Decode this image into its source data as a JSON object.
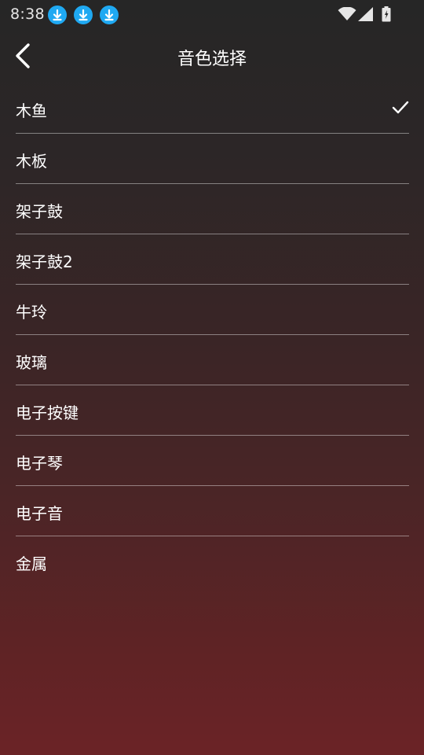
{
  "status_bar": {
    "time": "8:38",
    "notification_icons": [
      "download-icon",
      "download-icon",
      "download-icon"
    ],
    "icons": [
      "wifi-icon",
      "signal-icon",
      "battery-icon"
    ],
    "accent_color": "#1fa9f2"
  },
  "header": {
    "title": "音色选择",
    "back_icon": "back-arrow-icon"
  },
  "sounds": {
    "selected_index": 0,
    "items": [
      {
        "label": "木鱼",
        "selected": true
      },
      {
        "label": "木板",
        "selected": false
      },
      {
        "label": "架子鼓",
        "selected": false
      },
      {
        "label": "架子鼓2",
        "selected": false
      },
      {
        "label": "牛玲",
        "selected": false
      },
      {
        "label": "玻璃",
        "selected": false
      },
      {
        "label": "电子按键",
        "selected": false
      },
      {
        "label": "电子琴",
        "selected": false
      },
      {
        "label": "电子音",
        "selected": false
      },
      {
        "label": "金属",
        "selected": false
      }
    ]
  },
  "colors": {
    "background_top": "#262626",
    "background_bottom": "#6b2326",
    "text": "#ffffff"
  }
}
